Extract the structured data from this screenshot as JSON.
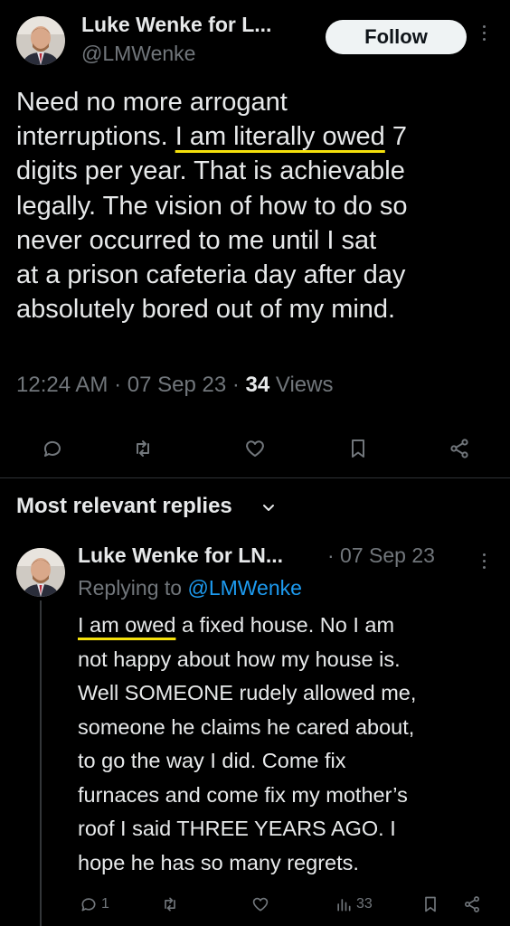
{
  "tweet": {
    "author_name": "Luke Wenke for L...",
    "handle": "@LMWenke",
    "follow_label": "Follow",
    "text_lines": [
      [
        "Need no more arrogant"
      ],
      [
        "interruptions.  ",
        "I am literally owed",
        " 7"
      ],
      [
        "digits per year.  That is achievable"
      ],
      [
        "legally.  The vision of how to do so"
      ],
      [
        "never occurred to me until I sat"
      ],
      [
        "at a prison cafeteria day after day"
      ],
      [
        "absolutely bored out of my mind."
      ]
    ],
    "time": "12:24 AM · 07 Sep 23 · ",
    "views_count": "34",
    "views_label": " Views",
    "actions": [
      "reply-icon",
      "retweet-icon",
      "like-icon",
      "bookmark-icon",
      "share-icon"
    ]
  },
  "replies_header": {
    "label": "Most relevant replies",
    "chevron": "chevron-down-icon"
  },
  "reply": {
    "author_name": "Luke Wenke for LN...",
    "time": "· 07 Sep 23",
    "replying_prefix": "Replying to ",
    "replying_to": "@LMWenke",
    "text_lines": [
      [
        "",
        "I am owed",
        " a fixed house.  No I am"
      ],
      [
        "not happy about how my house is."
      ],
      [
        "Well SOMEONE rudely allowed me,"
      ],
      [
        "someone he claims he cared about,"
      ],
      [
        "to go the way I did.  Come fix"
      ],
      [
        "furnaces and come fix my mother’s"
      ],
      [
        "roof I said THREE YEARS AGO.  I"
      ],
      [
        "hope he has so many regrets."
      ]
    ],
    "reply_count": "1",
    "views_count": "33"
  },
  "colors": {
    "background": "#000000",
    "text": "#e7e9ea",
    "muted": "#71767b",
    "link": "#1d9bf0",
    "highlight_underline": "#f5e10c"
  }
}
